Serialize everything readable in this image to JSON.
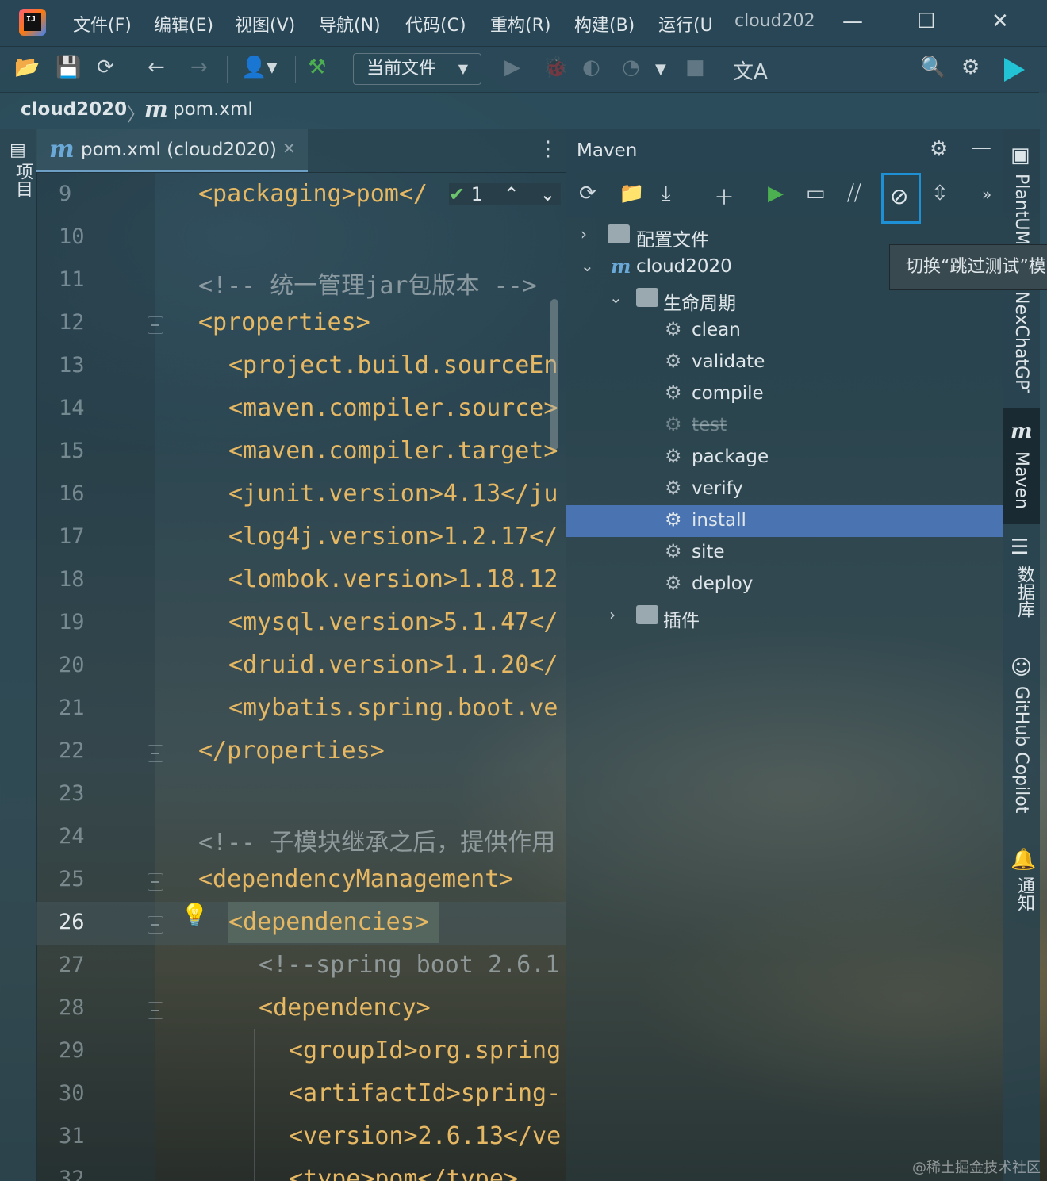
{
  "titlebar": {
    "menus": [
      "文件(F)",
      "编辑(E)",
      "视图(V)",
      "导航(N)",
      "代码(C)",
      "重构(R)",
      "构建(B)",
      "运行(U"
    ],
    "project": "cloud202"
  },
  "toolbar": {
    "config": "当前文件"
  },
  "breadcrumb": {
    "project": "cloud2020",
    "file": "pom.xml"
  },
  "left_stripe": {
    "project": "项目"
  },
  "editor": {
    "tab_label": "pom.xml (cloud2020)",
    "inspection_count": "1",
    "line_numbers": [
      "9",
      "10",
      "11",
      "12",
      "13",
      "14",
      "15",
      "16",
      "17",
      "18",
      "19",
      "20",
      "21",
      "22",
      "23",
      "24",
      "25",
      "26",
      "27",
      "28",
      "29",
      "30",
      "31",
      "32"
    ],
    "current_line": "26",
    "lines": [
      "<packaging>pom</",
      "",
      "<!-- 统一管理jar包版本 -->",
      "<properties>",
      "<project.build.sourceEn",
      "<maven.compiler.source>",
      "<maven.compiler.target>",
      "<junit.version>4.13</ju",
      "<log4j.version>1.2.17</",
      "<lombok.version>1.18.12",
      "<mysql.version>5.1.47</",
      "<druid.version>1.1.20</",
      "<mybatis.spring.boot.ve",
      "</properties>",
      "",
      "<!-- 子模块继承之后，提供作用",
      "<dependencyManagement>",
      "<dependencies>",
      "<!--spring boot 2.6.1",
      "<dependency>",
      "<groupId>org.spring",
      "<artifactId>spring-",
      "<version>2.6.13</ve",
      "<type>pom</type>"
    ]
  },
  "maven": {
    "title": "Maven",
    "tree": {
      "profiles": "配置文件",
      "project": "cloud2020",
      "lifecycle": "生命周期",
      "phases": [
        "clean",
        "validate",
        "compile",
        "test",
        "package",
        "verify",
        "install",
        "site",
        "deploy"
      ],
      "skipped_phase": "test",
      "selected_phase": "install",
      "plugins": "插件"
    },
    "tooltip": "切换“跳过测试”模式"
  },
  "right_stripe": {
    "tabs": [
      "PlantUML",
      "NexChatGPT",
      "Maven",
      "数据库",
      "GitHub Copilot",
      "通知"
    ]
  },
  "watermark": "@稀土掘金技术社区",
  "colors": {
    "accent": "#1e90d6",
    "selection": "#4a73b2",
    "xml_tag": "#e6b863",
    "run": "#4caf50"
  }
}
